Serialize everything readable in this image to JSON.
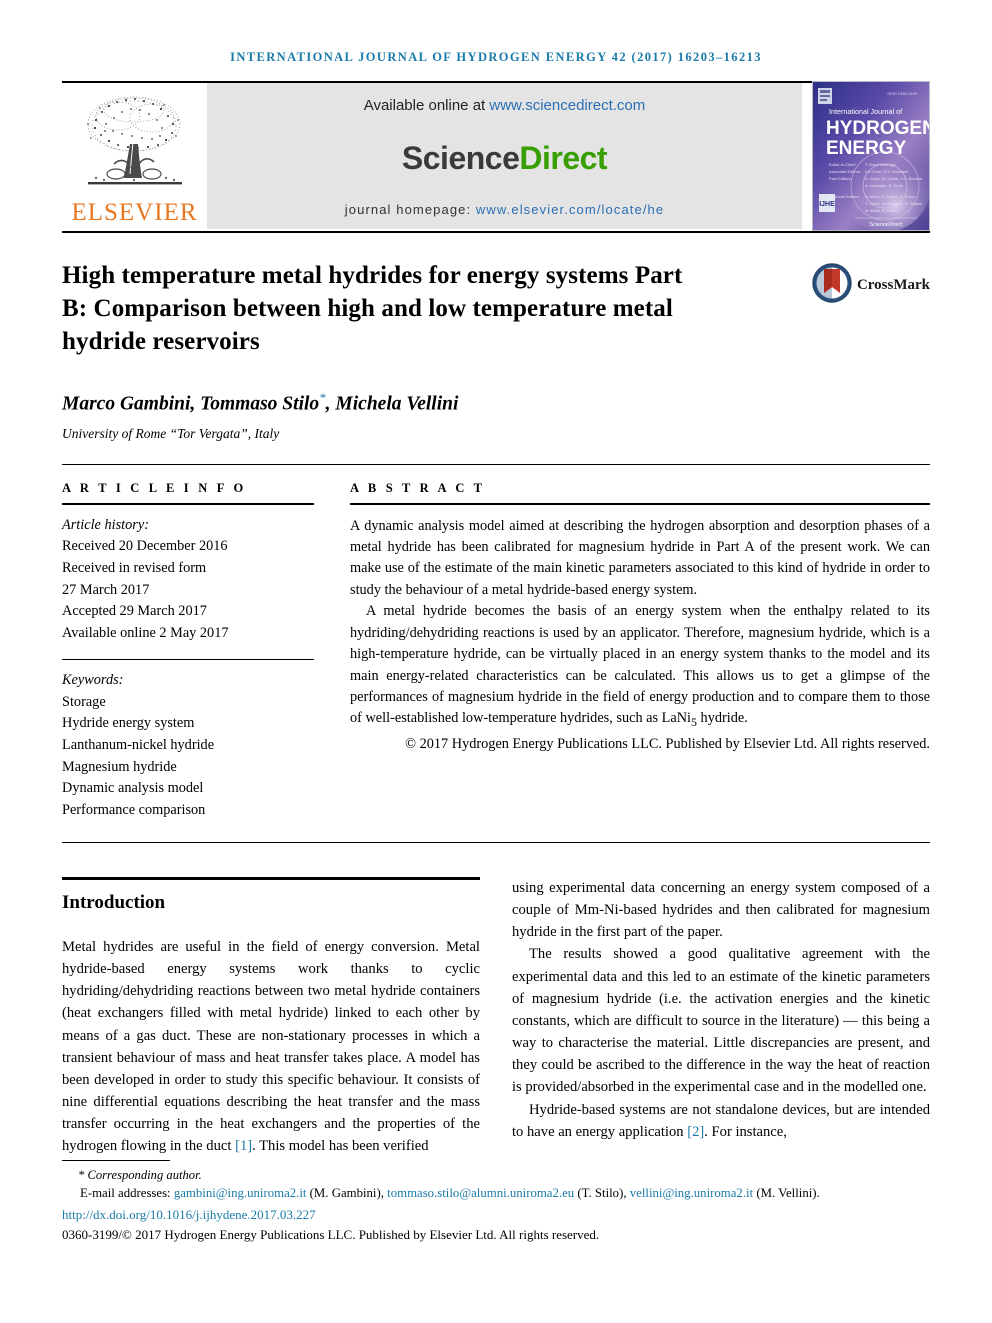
{
  "running_head": "INTERNATIONAL JOURNAL OF HYDROGEN ENERGY 42 (2017) 16203–16213",
  "masthead": {
    "publisher_name": "ELSEVIER",
    "available_prefix": "Available online at ",
    "available_url": "www.sciencedirect.com",
    "sciencedirect_part1": "Science",
    "sciencedirect_part2": "Direct",
    "homepage_label": "journal homepage: ",
    "homepage_url": "www.elsevier.com/locate/he",
    "cover": {
      "line1": "International Journal of",
      "line2": "HYDROGEN",
      "line3": "ENERGY",
      "badge": "IJHE",
      "footer": "ScienceDirect"
    }
  },
  "article": {
    "title": "High temperature metal hydrides for energy systems Part B: Comparison between high and low temperature metal hydride reservoirs",
    "crossmark_label": "CrossMark",
    "authors": "Marco Gambini, Tommaso Stilo",
    "authors_tail": ", Michela Vellini",
    "corresponding_marker": "*",
    "affiliation": "University of Rome “Tor Vergata”, Italy"
  },
  "info": {
    "heading": "A R T I C L E  I N F O",
    "history_title": "Article history:",
    "history": [
      "Received 20 December 2016",
      "Received in revised form",
      "27 March 2017",
      "Accepted 29 March 2017",
      "Available online 2 May 2017"
    ],
    "keywords_title": "Keywords:",
    "keywords": [
      "Storage",
      "Hydride energy system",
      "Lanthanum-nickel hydride",
      "Magnesium hydride",
      "Dynamic analysis model",
      "Performance comparison"
    ]
  },
  "abstract": {
    "heading": "A B S T R A C T",
    "paragraph1": "A dynamic analysis model aimed at describing the hydrogen absorption and desorption phases of a metal hydride has been calibrated for magnesium hydride in Part A of the present work. We can make use of the estimate of the main kinetic parameters associated to this kind of hydride in order to study the behaviour of a metal hydride-based energy system.",
    "paragraph2_pre": "A metal hydride becomes the basis of an energy system when the enthalpy related to its hydriding/dehydriding reactions is used by an applicator. Therefore, magnesium hydride, which is a high-temperature hydride, can be virtually placed in an energy system thanks to the model and its main energy-related characteristics can be calculated. This allows us to get a glimpse of the performances of magnesium hydride in the field of energy production and to compare them to those of well-established low-temperature hydrides, such as LaNi",
    "paragraph2_sub": "5",
    "paragraph2_post": " hydride.",
    "copyright": "© 2017 Hydrogen Energy Publications LLC. Published by Elsevier Ltd. All rights reserved."
  },
  "introduction": {
    "heading": "Introduction",
    "left_p1_pre": "Metal hydrides are useful in the field of energy conversion. Metal hydride-based energy systems work thanks to cyclic hydriding/dehydriding reactions between two metal hydride containers (heat exchangers filled with metal hydride) linked to each other by means of a gas duct. These are non-stationary processes in which a transient behaviour of mass and heat transfer takes place. A model has been developed in order to study this specific behaviour. It consists of nine differential equations describing the heat transfer and the mass transfer occurring in the heat exchangers and the properties of the hydrogen flowing in the duct ",
    "left_cite1": "[1]",
    "left_p1_post": ". This model has been verified",
    "right_p1": "using experimental data concerning an energy system composed of a couple of Mm-Ni-based hydrides and then calibrated for magnesium hydride in the first part of the paper.",
    "right_p2": "The results showed a good qualitative agreement with the experimental data and this led to an estimate of the kinetic parameters of magnesium hydride (i.e. the activation energies and the kinetic constants, which are difficult to source in the literature) — this being a way to characterise the material. Little discrepancies are present, and they could be ascribed to the difference in the way the heat of reaction is provided/absorbed in the experimental case and in the modelled one.",
    "right_p3_pre": "Hydride-based systems are not standalone devices, but are intended to have an energy application ",
    "right_cite2": "[2]",
    "right_p3_post": ". For instance,"
  },
  "footer": {
    "corresponding": "* Corresponding author.",
    "email_label": "E-mail addresses: ",
    "email1": "gambini@ing.uniroma2.it",
    "email1_name": " (M. Gambini), ",
    "email2": "tommaso.stilo@alumni.uniroma2.eu",
    "email2_name": " (T. Stilo), ",
    "email3": "vellini@ing.uniroma2.it",
    "email3_name": " (M. Vellini).",
    "doi": "http://dx.doi.org/10.1016/j.ijhydene.2017.03.227",
    "issn_copyright": "0360-3199/© 2017 Hydrogen Energy Publications LLC. Published by Elsevier Ltd. All rights reserved."
  },
  "colors": {
    "link": "#1a7aa8",
    "sciencedirect_green": "#37a000",
    "elsevier_orange": "#E87722",
    "band_gray": "#e4e4e4"
  }
}
